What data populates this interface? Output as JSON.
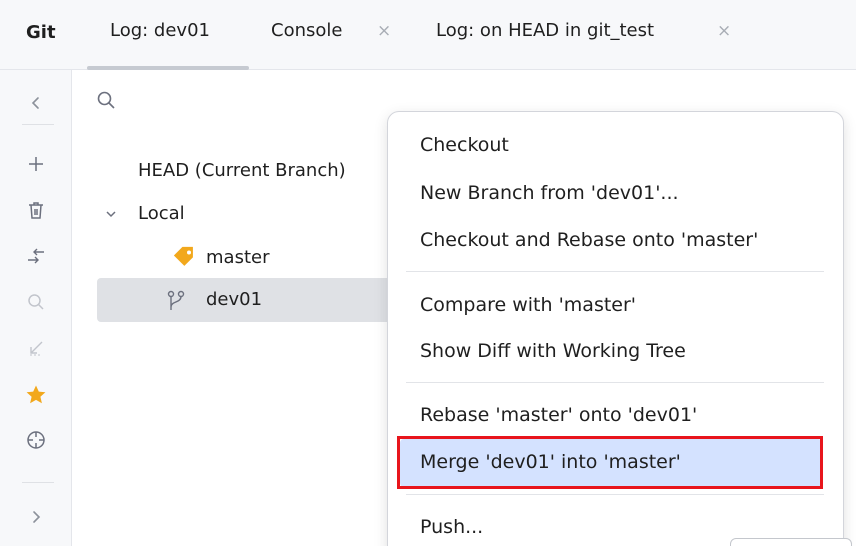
{
  "tabbar": {
    "tool_title": "Git",
    "tabs": [
      {
        "label": "Log: dev01",
        "active": true,
        "closable": false
      },
      {
        "label": "Console",
        "active": false,
        "closable": true
      },
      {
        "label": "Log: on HEAD in git_test",
        "active": false,
        "closable": true
      }
    ],
    "close_glyph": "×"
  },
  "left_toolbar": {
    "icons": [
      "chevron-left-icon",
      "plus-icon",
      "trash-icon",
      "fetch-arrows-icon",
      "search-icon",
      "collapse-icon",
      "star-icon",
      "crosshair-icon",
      "chevron-right-icon"
    ],
    "star_color": "#f2a81c"
  },
  "tree": {
    "head_label": "HEAD (Current Branch)",
    "local_label": "Local",
    "branches": [
      {
        "name": "master",
        "icon": "tag-icon",
        "icon_color": "#f2a81c",
        "selected": false
      },
      {
        "name": "dev01",
        "icon": "branch-icon",
        "selected": true
      }
    ]
  },
  "context_menu": {
    "groups": [
      [
        "Checkout",
        "New Branch from 'dev01'...",
        "Checkout and Rebase onto 'master'"
      ],
      [
        "Compare with 'master'",
        "Show Diff with Working Tree"
      ],
      [
        "Rebase 'master' onto 'dev01'",
        "Merge 'dev01' into 'master'"
      ],
      [
        "Push..."
      ]
    ],
    "highlighted_item": "Merge 'dev01' into 'master'",
    "highlight_color": "#d4e2ff",
    "annotation_color": "#e8151c"
  }
}
